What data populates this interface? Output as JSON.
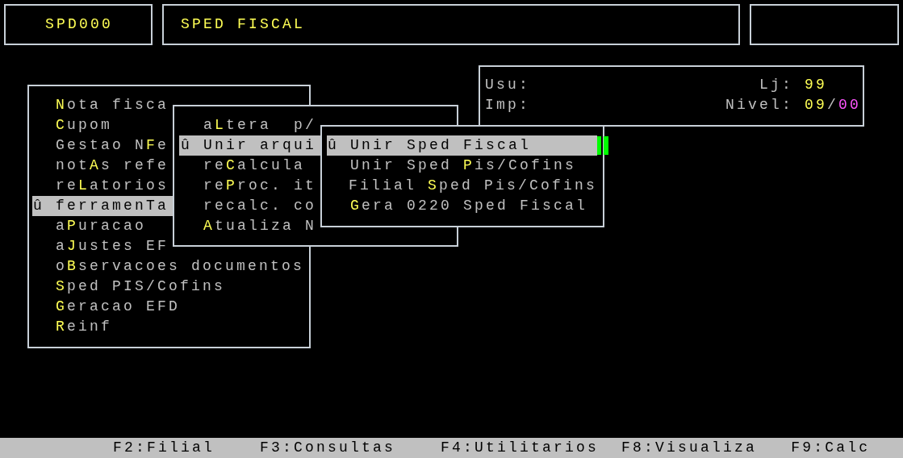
{
  "header": {
    "program_code": "SPD000",
    "title": "SPED FISCAL"
  },
  "info_panel": {
    "user_label": "Usu:",
    "printer_label": "Imp:",
    "store_label": "Lj:",
    "store_value": "99",
    "level_label": "Nivel:",
    "level_current": "09",
    "level_separator": "/",
    "level_limit": "00"
  },
  "menus": [
    {
      "marker": "û",
      "items": [
        {
          "label": "**N**ota fisca",
          "selected": false
        },
        {
          "label": "**C**upom",
          "selected": false
        },
        {
          "label": "Gestao N**F**e",
          "selected": false
        },
        {
          "label": "not**A**s refe",
          "selected": false
        },
        {
          "label": "re**L**atorios",
          "selected": false
        },
        {
          "label": "ferramenTa",
          "selected": true
        },
        {
          "label": "a**P**uracao",
          "selected": false
        },
        {
          "label": "a**J**ustes EF",
          "selected": false
        },
        {
          "label": "o**B**servacoes documentos",
          "selected": false
        },
        {
          "label": "**S**ped PIS/Cofins",
          "selected": false
        },
        {
          "label": "**G**eracao EFD",
          "selected": false
        },
        {
          "label": "**R**einf",
          "selected": false
        }
      ]
    },
    {
      "marker": "û",
      "items": [
        {
          "label": "a**L**tera  p/",
          "selected": false
        },
        {
          "label": "Unir arqui",
          "selected": true
        },
        {
          "label": "re**C**alcula",
          "selected": false
        },
        {
          "label": "re**P**roc. it",
          "selected": false
        },
        {
          "label": "recalc. co",
          "selected": false
        },
        {
          "label": "**A**tualiza N",
          "selected": false
        }
      ]
    },
    {
      "marker": "û",
      "items": [
        {
          "label": "Unir Sped Fiscal",
          "selected": true
        },
        {
          "label": "Unir Sped **P**is/Cofins",
          "selected": false
        },
        {
          "label": "Filial **S**ped Pis/Cofins",
          "selected": false
        },
        {
          "label": "**G**era 0220 Sped Fiscal",
          "selected": false
        }
      ]
    }
  ],
  "status_bar": [
    "F2:Filial",
    "F3:Consultas",
    "F4:Utilitarios",
    "F8:Visualiza",
    "F9:Calc"
  ]
}
